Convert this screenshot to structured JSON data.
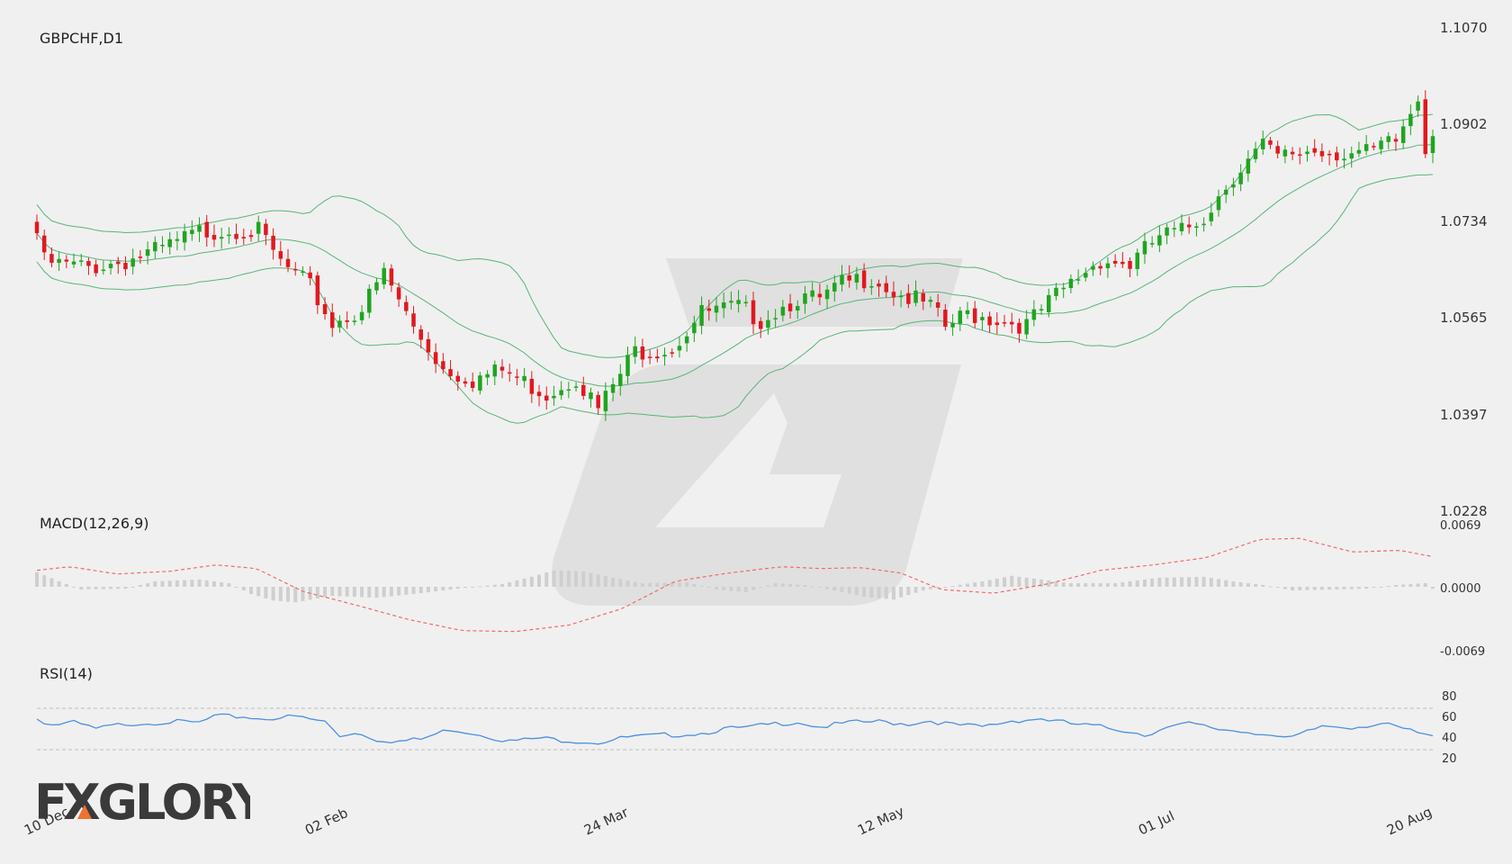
{
  "chart_data": [
    {
      "type": "candlestick",
      "title": "GBPCHF,D1",
      "ylim": [
        1.0228,
        1.107
      ],
      "y_ticks": [
        "1.1070",
        "1.0902",
        "1.0734",
        "1.0565",
        "1.0397",
        "1.0228"
      ],
      "x_tick_labels": [
        "10 Dec",
        "02 Feb",
        "24 Mar",
        "12 May",
        "01 Jul",
        "20 Aug"
      ],
      "x_tick_bar_index": [
        0,
        38,
        76,
        113,
        151,
        189
      ],
      "bar_count": 190,
      "close_anchors": [
        [
          0,
          1.071
        ],
        [
          1,
          1.066
        ],
        [
          3,
          1.0655
        ],
        [
          7,
          1.065
        ],
        [
          12,
          1.0662
        ],
        [
          17,
          1.0682
        ],
        [
          22,
          1.0712
        ],
        [
          27,
          1.0718
        ],
        [
          30,
          1.0712
        ],
        [
          33,
          1.0658
        ],
        [
          37,
          1.0615
        ],
        [
          40,
          1.0552
        ],
        [
          44,
          1.0578
        ],
        [
          47,
          1.064
        ],
        [
          51,
          1.0545
        ],
        [
          55,
          1.0475
        ],
        [
          59,
          1.0455
        ],
        [
          63,
          1.047
        ],
        [
          69,
          1.043
        ],
        [
          73,
          1.046
        ],
        [
          76,
          1.0402
        ],
        [
          81,
          1.0505
        ],
        [
          86,
          1.051
        ],
        [
          90,
          1.057
        ],
        [
          95,
          1.058
        ],
        [
          98,
          1.056
        ],
        [
          103,
          1.0598
        ],
        [
          106,
          1.0592
        ],
        [
          109,
          1.062
        ],
        [
          113,
          1.0635
        ],
        [
          116,
          1.0608
        ],
        [
          119,
          1.0592
        ],
        [
          121,
          1.058
        ],
        [
          123,
          1.0545
        ],
        [
          126,
          1.057
        ],
        [
          130,
          1.056
        ],
        [
          134,
          1.055
        ],
        [
          138,
          1.06
        ],
        [
          142,
          1.0645
        ],
        [
          144,
          1.0665
        ],
        [
          148,
          1.0655
        ],
        [
          152,
          1.0705
        ],
        [
          155,
          1.0712
        ],
        [
          158,
          1.074
        ],
        [
          162,
          1.0812
        ],
        [
          166,
          1.0862
        ],
        [
          168,
          1.084
        ],
        [
          172,
          1.0855
        ],
        [
          176,
          1.0852
        ],
        [
          180,
          1.0848
        ],
        [
          184,
          1.087
        ],
        [
          187,
          1.0945
        ],
        [
          188,
          1.0858
        ],
        [
          189,
          1.0895
        ]
      ],
      "indicator": "Bollinger Bands",
      "colors": {
        "bull": "#1fa51f",
        "bear": "#e0191f",
        "band": "#5ab47a"
      }
    },
    {
      "type": "bar+line",
      "title": "MACD(12,26,9)",
      "ylim": [
        -0.0069,
        0.0069
      ],
      "y_ticks": [
        "0.0069",
        "0.0000",
        "-0.0069"
      ],
      "signal_anchors": [
        [
          0,
          0.0018
        ],
        [
          5,
          0.0022
        ],
        [
          12,
          0.0014
        ],
        [
          20,
          0.0017
        ],
        [
          27,
          0.0024
        ],
        [
          33,
          0.002
        ],
        [
          40,
          -0.0005
        ],
        [
          48,
          -0.002
        ],
        [
          56,
          -0.0036
        ],
        [
          64,
          -0.0048
        ],
        [
          72,
          -0.0049
        ],
        [
          80,
          -0.0042
        ],
        [
          88,
          -0.0024
        ],
        [
          96,
          0.0006
        ],
        [
          104,
          0.0015
        ],
        [
          112,
          0.0022
        ],
        [
          118,
          0.002
        ],
        [
          124,
          0.0021
        ],
        [
          130,
          0.0015
        ],
        [
          136,
          -0.0003
        ],
        [
          144,
          -0.0007
        ],
        [
          152,
          0.0003
        ],
        [
          160,
          0.0018
        ],
        [
          168,
          0.0024
        ],
        [
          176,
          0.0032
        ],
        [
          184,
          0.0052
        ],
        [
          190,
          0.0053
        ],
        [
          198,
          0.0038
        ],
        [
          205,
          0.004
        ],
        [
          210,
          0.0033
        ]
      ],
      "hist_anchors": [
        [
          0,
          0.0016
        ],
        [
          3,
          0.0006
        ],
        [
          6,
          -0.0003
        ],
        [
          12,
          -0.0002
        ],
        [
          16,
          0.0006
        ],
        [
          22,
          0.0008
        ],
        [
          26,
          0.0004
        ],
        [
          29,
          -0.0008
        ],
        [
          32,
          -0.0015
        ],
        [
          35,
          -0.0017
        ],
        [
          40,
          -0.001
        ],
        [
          46,
          -0.0012
        ],
        [
          52,
          -0.0007
        ],
        [
          57,
          -0.0002
        ],
        [
          63,
          0.0003
        ],
        [
          67,
          0.0011
        ],
        [
          70,
          0.0018
        ],
        [
          74,
          0.0017
        ],
        [
          78,
          0.001
        ],
        [
          82,
          0.0004
        ],
        [
          88,
          0.0005
        ],
        [
          92,
          -0.0003
        ],
        [
          96,
          -0.0006
        ],
        [
          100,
          0.0004
        ],
        [
          104,
          0.0002
        ],
        [
          108,
          -0.0004
        ],
        [
          112,
          -0.0011
        ],
        [
          116,
          -0.0014
        ],
        [
          120,
          -0.0004
        ],
        [
          124,
          0.0001
        ],
        [
          128,
          0.0006
        ],
        [
          132,
          0.0012
        ],
        [
          136,
          0.0008
        ],
        [
          140,
          0.0004
        ],
        [
          146,
          0.0004
        ],
        [
          152,
          0.001
        ],
        [
          158,
          0.0011
        ],
        [
          162,
          0.0006
        ],
        [
          166,
          0.0002
        ],
        [
          170,
          -0.0004
        ],
        [
          176,
          -0.0003
        ],
        [
          180,
          -0.0002
        ],
        [
          184,
          0.0002
        ],
        [
          188,
          0.0004
        ],
        [
          190,
          -0.0008
        ]
      ],
      "colors": {
        "hist": "#cfcfcf",
        "signal": "#f26a6a"
      }
    },
    {
      "type": "line",
      "title": "RSI(14)",
      "ylim": [
        0,
        100
      ],
      "y_ticks": [
        "80",
        "60",
        "40",
        "20"
      ],
      "levels": [
        70,
        30
      ],
      "anchors": [
        [
          0,
          60
        ],
        [
          2,
          54
        ],
        [
          5,
          56
        ],
        [
          8,
          50
        ],
        [
          12,
          55
        ],
        [
          18,
          57
        ],
        [
          22,
          56
        ],
        [
          24,
          62
        ],
        [
          28,
          62
        ],
        [
          30,
          60
        ],
        [
          35,
          62
        ],
        [
          39,
          57
        ],
        [
          41,
          43
        ],
        [
          43,
          47
        ],
        [
          46,
          40
        ],
        [
          49,
          38
        ],
        [
          52,
          40
        ],
        [
          56,
          50
        ],
        [
          60,
          45
        ],
        [
          64,
          38
        ],
        [
          68,
          41
        ],
        [
          72,
          39
        ],
        [
          76,
          37
        ],
        [
          80,
          42
        ],
        [
          85,
          44
        ],
        [
          90,
          46
        ],
        [
          93,
          50
        ],
        [
          96,
          51
        ],
        [
          100,
          55
        ],
        [
          103,
          57
        ],
        [
          106,
          52
        ],
        [
          110,
          56
        ],
        [
          114,
          57
        ],
        [
          118,
          55
        ],
        [
          121,
          58
        ],
        [
          124,
          54
        ],
        [
          128,
          52
        ],
        [
          132,
          58
        ],
        [
          136,
          60
        ],
        [
          140,
          55
        ],
        [
          144,
          52
        ],
        [
          148,
          48
        ],
        [
          150,
          44
        ],
        [
          152,
          50
        ],
        [
          156,
          55
        ],
        [
          160,
          50
        ],
        [
          163,
          48
        ],
        [
          166,
          46
        ],
        [
          169,
          40
        ],
        [
          171,
          44
        ],
        [
          174,
          53
        ],
        [
          178,
          52
        ],
        [
          182,
          55
        ],
        [
          185,
          50
        ],
        [
          189,
          42
        ]
      ],
      "colors": {
        "line": "#4a90e2",
        "level": "#bbbbbb"
      }
    }
  ],
  "brand": {
    "text": "FXGLORY",
    "accent": "#f07030"
  }
}
